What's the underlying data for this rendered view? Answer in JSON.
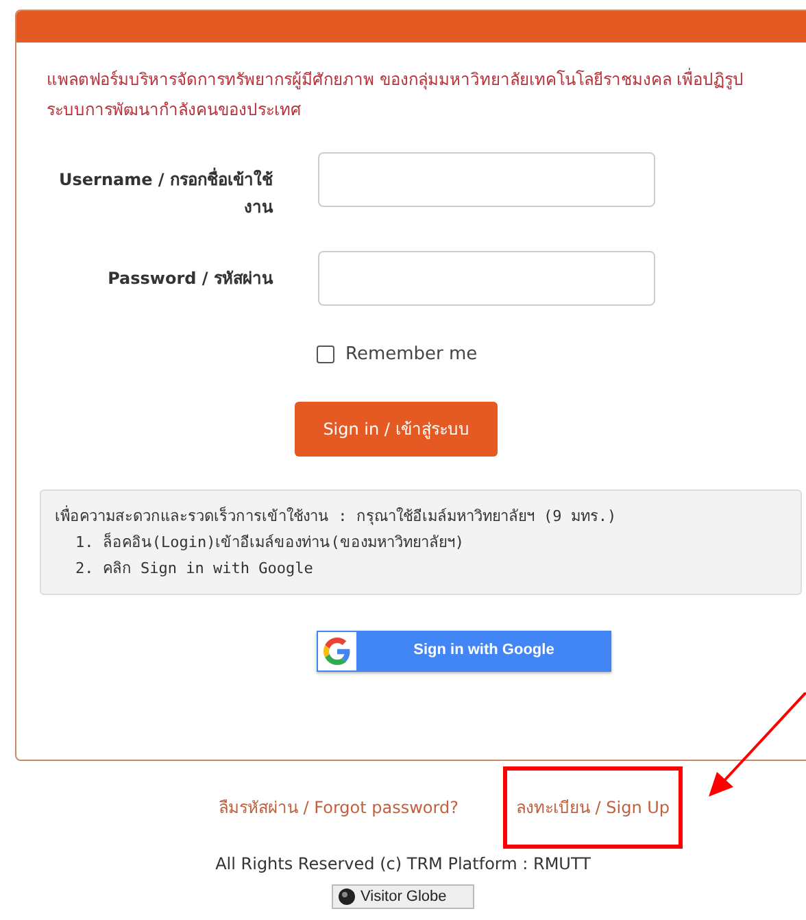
{
  "intro": "แพลตฟอร์มบริหารจัดการทรัพยากรผู้มีศักยภาพ ของกลุ่มมหาวิทยาลัยเทคโนโลยีราชมงคล เพื่อปฏิรูประบบการพัฒนากำลังคนของประเทศ",
  "fields": [
    {
      "label": "Username / กรอกชื่อเข้าใช้งาน"
    },
    {
      "label": "Password / รหัสผ่าน"
    }
  ],
  "remember": {
    "label": "Remember me",
    "checked": false
  },
  "sign_in": "Sign in / เข้าสู่ระบบ",
  "note": {
    "heading": "เพื่อความสะดวกและรวดเร็วการเข้าใช้งาน : กรุณาใช้อีเมล์มหาวิทยาลัยฯ (9 มทร.)",
    "steps": [
      "1. ล็อคอิน(Login)เข้าอีเมล์ของท่าน(ของมหาวิทยาลัยฯ)",
      "2. คลิก Sign in with Google"
    ]
  },
  "google_button": "Sign in with Google",
  "links": [
    {
      "label": "ลืมรหัสผ่าน / Forgot password?",
      "highlighted": false
    },
    {
      "label": "ลงทะเบียน / Sign Up",
      "highlighted": true
    }
  ],
  "copyright": "All Rights Reserved (c) TRM Platform : RMUTT",
  "visitor_globe": "Visitor Globe"
}
